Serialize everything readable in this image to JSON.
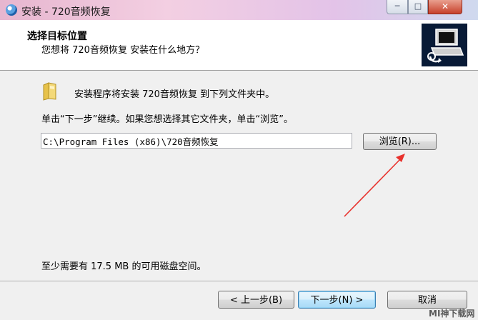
{
  "window": {
    "title": "安装 - 720音频恢复",
    "icon": "app-disc-icon",
    "controls": {
      "minimize": "minimize-icon",
      "maximize": "maximize-icon",
      "close": "close-icon"
    }
  },
  "header": {
    "title": "选择目标位置",
    "subtitle": "您想将 720音频恢复 安装在什么地方？",
    "logo": "installer-computer-icon"
  },
  "main": {
    "folder_icon": "folder-icon",
    "info": "安装程序将安装 720音频恢复 到下列文件夹中。",
    "instruction": "单击“下一步”继续。如果您想选择其它文件夹，单击“浏览”。",
    "path_value": "C:\\Program Files (x86)\\720音频恢复",
    "browse_label": "浏览(R)...",
    "space_required": "至少需要有 17.5 MB 的可用磁盘空间。"
  },
  "footer": {
    "back_label": "< 上一步(B)",
    "next_label": "下一步(N) >",
    "cancel_label": "取消"
  },
  "annotation": {
    "arrow_color": "#e8322d"
  },
  "watermark": "MI神下载网"
}
